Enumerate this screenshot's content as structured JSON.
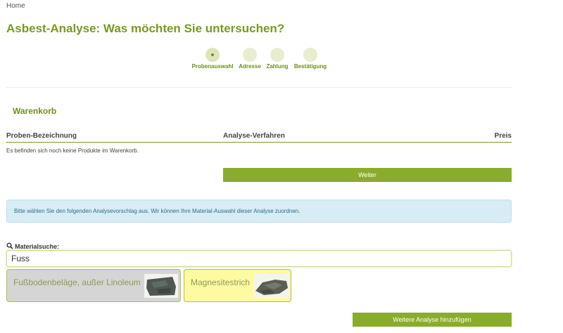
{
  "breadcrumb": {
    "home": "Home"
  },
  "page": {
    "title": "Asbest-Analyse: Was möchten Sie untersuchen?"
  },
  "steps": [
    {
      "label": "Probenauswahl",
      "active": true
    },
    {
      "label": "Adresse",
      "active": false
    },
    {
      "label": "Zahlung",
      "active": false
    },
    {
      "label": "Bestätigung",
      "active": false
    }
  ],
  "cart": {
    "title": "Warenkorb",
    "columns": {
      "name": "Proben-Bezeichnung",
      "method": "Analyse-Verfahren",
      "price": "Preis"
    },
    "empty_message": "Es befinden sich noch keine Produkte im Warenkorb.",
    "next_label": "Weiter"
  },
  "info": {
    "text": "Bitte wählen Sie den folgenden Analysevorschlag aus. Wir können Ihre Material-Auswahl dieser Analyse zuordnen."
  },
  "search": {
    "label": "Materialsuche:",
    "value": "Fuss",
    "icon": "search-icon"
  },
  "materials": [
    {
      "label": "Fußbodenbeläge, außer Linoleum",
      "color": "#d5d5d5"
    },
    {
      "label": "Magnesitestrich",
      "color": "#fdfaa2"
    }
  ],
  "actions": {
    "add_more_label": "Weitere Analyse hinzufügen"
  },
  "colors": {
    "accent": "#8aac2b",
    "title": "#7a9a1f",
    "info_bg": "#d7ecf4"
  }
}
